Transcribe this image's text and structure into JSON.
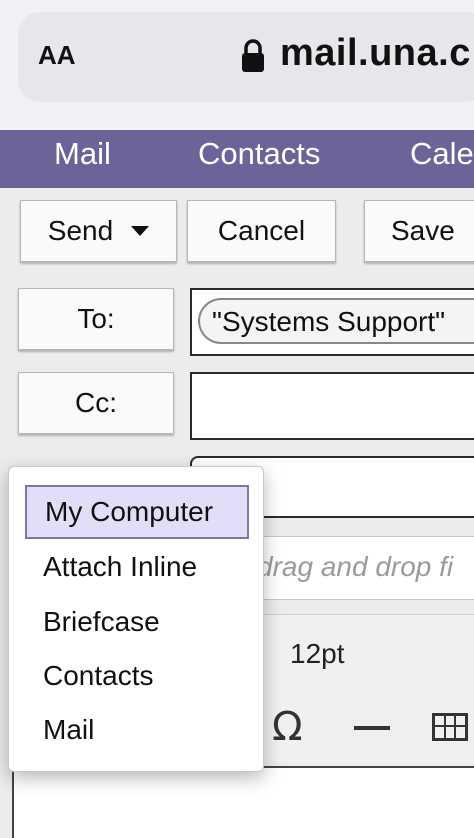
{
  "browser": {
    "text_size_label": "AA",
    "url": "mail.una.c"
  },
  "nav": {
    "items": [
      "Mail",
      "Contacts",
      "Cale"
    ]
  },
  "toolbar": {
    "send_label": "Send",
    "cancel_label": "Cancel",
    "save_label": "Save"
  },
  "header": {
    "to_label": "To:",
    "cc_label": "Cc:",
    "to_recipient": "\"Systems Support\""
  },
  "attachments": {
    "drop_hint": "drag and drop fi"
  },
  "editor": {
    "font_size": "12pt",
    "special_char_icon": "omega-icon",
    "horizontal_rule_icon": "horizontal-rule-icon",
    "table_icon": "table-icon"
  },
  "attach_menu": {
    "items": [
      "My Computer",
      "Attach Inline",
      "Briefcase",
      "Contacts",
      "Mail"
    ],
    "selected_index": 0
  },
  "colors": {
    "nav_bg": "#6e6399",
    "menu_selected_bg": "#e1dff7",
    "menu_selected_border": "#7c77ad"
  }
}
